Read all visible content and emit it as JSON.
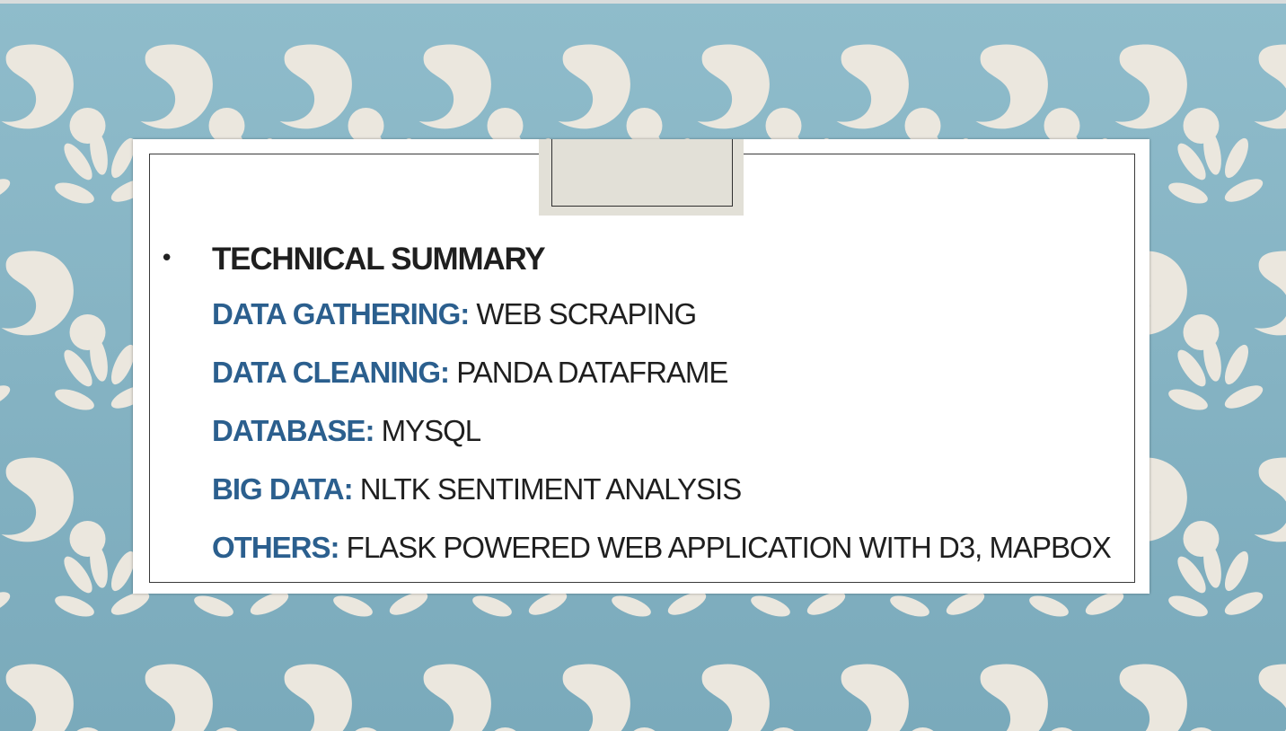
{
  "slide": {
    "colors": {
      "background": "#86b4c4",
      "pattern": "#ebe7de",
      "label": "#2b5f8e",
      "text": "#1f1f1f",
      "tab": "#e2e0d7"
    },
    "bullet": "•",
    "heading": "TECHNICAL SUMMARY",
    "items": [
      {
        "label": "DATA GATHERING:",
        "value": "WEB SCRAPING"
      },
      {
        "label": "DATA CLEANING:",
        "value": "PANDA DATAFRAME"
      },
      {
        "label": "DATABASE:",
        "value": "MYSQL"
      },
      {
        "label": "BIG DATA:",
        "value": "NLTK SENTIMENT ANALYSIS"
      },
      {
        "label": "OTHERS:",
        "value": "FLASK POWERED WEB APPLICATION WITH D3, MAPBOX"
      }
    ]
  }
}
